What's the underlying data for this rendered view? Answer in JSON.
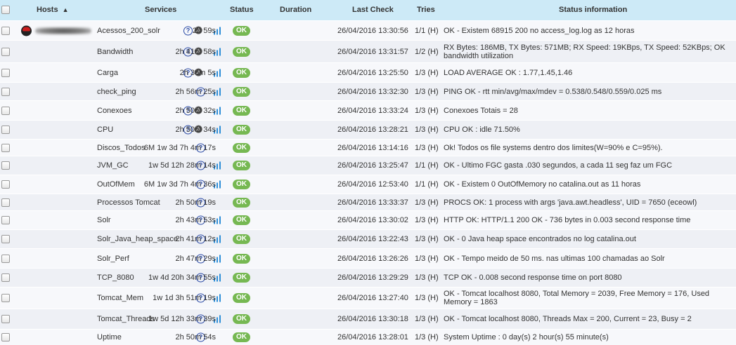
{
  "header": {
    "hosts": "Hosts",
    "services": "Services",
    "status": "Status",
    "duration": "Duration",
    "last_check": "Last Check",
    "tries": "Tries",
    "status_information": "Status information",
    "sort_icon": "chevron-up-icon"
  },
  "colors": {
    "header_bg": "#cdeaf7",
    "ok_badge": "#76b852",
    "help_icon": "#2a4aa6",
    "graph_icon": "#2f8fd8"
  },
  "rows": [
    {
      "service": "Acessos_200_solr",
      "status": "OK",
      "duration": "2h 59s",
      "last_check": "26/04/2016 13:30:56",
      "tries": "1/1 (H)",
      "info": "OK - Existem 68915 200 no access_log.log as 12 horas"
    },
    {
      "service": "Bandwidth",
      "status": "OK",
      "duration": "2h 41m 58s",
      "last_check": "26/04/2016 13:31:57",
      "tries": "1/2 (H)",
      "info": "RX Bytes: 186MB, TX Bytes: 571MB; RX Speed: 19KBps, TX Speed: 52KBps; OK bandwidth utilization"
    },
    {
      "service": "Carga",
      "status": "OK",
      "duration": "2h 38m 5s",
      "last_check": "26/04/2016 13:25:50",
      "tries": "1/3 (H)",
      "info": "LOAD AVERAGE OK : 1.77,1.45,1.46"
    },
    {
      "service": "check_ping",
      "status": "OK",
      "duration": "2h 56m 25s",
      "last_check": "26/04/2016 13:32:30",
      "tries": "1/3 (H)",
      "info": "PING OK - rtt min/avg/max/mdev = 0.538/0.548/0.559/0.025 ms"
    },
    {
      "service": "Conexoes",
      "status": "OK",
      "duration": "2h 50m 32s",
      "last_check": "26/04/2016 13:33:24",
      "tries": "1/3 (H)",
      "info": "Conexoes Totais = 28"
    },
    {
      "service": "CPU",
      "status": "OK",
      "duration": "2h 50m 34s",
      "last_check": "26/04/2016 13:28:21",
      "tries": "1/3 (H)",
      "info": "CPU OK : idle 71.50%"
    },
    {
      "service": "Discos_Todos",
      "status": "OK",
      "duration": "6M 1w 3d 7h 4m 17s",
      "last_check": "26/04/2016 13:14:16",
      "tries": "1/3 (H)",
      "info": "Ok! Todos os file systems dentro dos limites(W=90% e C=95%)."
    },
    {
      "service": "JVM_GC",
      "status": "OK",
      "duration": "1w 5d 12h 28m 14s",
      "last_check": "26/04/2016 13:25:47",
      "tries": "1/1 (H)",
      "info": "OK - Ultimo FGC gasta .030 segundos, a cada 11 seg faz um FGC"
    },
    {
      "service": "OutOfMem",
      "status": "OK",
      "duration": "6M 1w 3d 7h 4m 36s",
      "last_check": "26/04/2016 12:53:40",
      "tries": "1/1 (H)",
      "info": "OK - Existem 0 OutOfMemory no catalina.out as 11 horas"
    },
    {
      "service": "Processos Tomcat",
      "status": "OK",
      "duration": "2h 50m 19s",
      "last_check": "26/04/2016 13:33:37",
      "tries": "1/3 (H)",
      "info": "PROCS OK: 1 process with args 'java.awt.headless', UID = 7650 (eceowl)"
    },
    {
      "service": "Solr",
      "status": "OK",
      "duration": "2h 43m 53s",
      "last_check": "26/04/2016 13:30:02",
      "tries": "1/3 (H)",
      "info": "HTTP OK: HTTP/1.1 200 OK - 736 bytes in 0.003 second response time"
    },
    {
      "service": "Solr_Java_heap_space",
      "status": "OK",
      "duration": "2h 41m 12s",
      "last_check": "26/04/2016 13:22:43",
      "tries": "1/3 (H)",
      "info": "OK - 0 Java heap space encontrados no log catalina.out"
    },
    {
      "service": "Solr_Perf",
      "status": "OK",
      "duration": "2h 47m 29s",
      "last_check": "26/04/2016 13:26:26",
      "tries": "1/3 (H)",
      "info": "OK - Tempo meido de 50 ms. nas ultimas 100 chamadas ao Solr"
    },
    {
      "service": "TCP_8080",
      "status": "OK",
      "duration": "1w 4d 20h 34m 55s",
      "last_check": "26/04/2016 13:29:29",
      "tries": "1/3 (H)",
      "info": "TCP OK - 0.008 second response time on port 8080"
    },
    {
      "service": "Tomcat_Mem",
      "status": "OK",
      "duration": "1w 1d 3h 51m 19s",
      "last_check": "26/04/2016 13:27:40",
      "tries": "1/3 (H)",
      "info": "OK - Tomcat localhost 8080, Total Memory = 2039, Free Memory = 176, Used Memory = 1863"
    },
    {
      "service": "Tomcat_Threads",
      "status": "OK",
      "duration": "1w 5d 12h 33m 39s",
      "last_check": "26/04/2016 13:30:18",
      "tries": "1/3 (H)",
      "info": "OK - Tomcat localhost 8080, Threads Max = 200, Current = 23, Busy = 2"
    },
    {
      "service": "Uptime",
      "status": "OK",
      "duration": "2h 50m 54s",
      "last_check": "26/04/2016 13:28:01",
      "tries": "1/3 (H)",
      "info": "System Uptime : 0 day(s) 2 hour(s) 55 minute(s)"
    }
  ]
}
